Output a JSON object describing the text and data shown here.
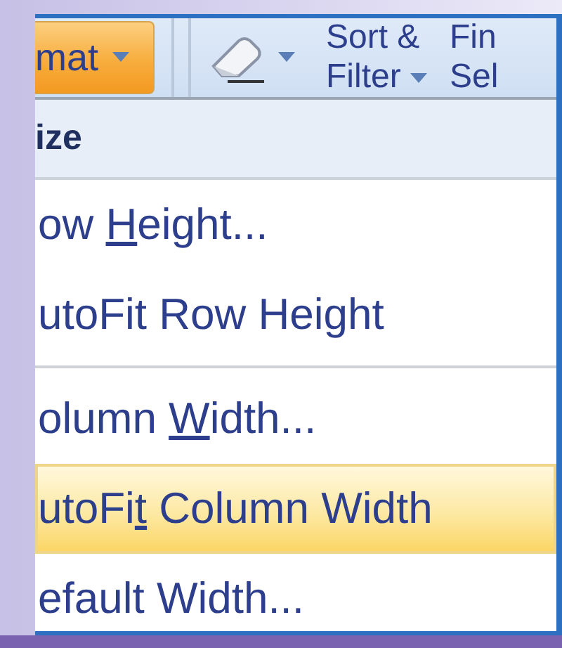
{
  "ribbon": {
    "format_button": {
      "label": "mat",
      "pressed": true
    },
    "clear_button": {
      "pressed": false
    },
    "sort_filter": {
      "line_1": "Sort &",
      "line_2": "Filter"
    },
    "find_select": {
      "line_1": "Fin",
      "line_2": "Sel"
    }
  },
  "menu": {
    "header": "ize",
    "items": [
      {
        "kind": "item",
        "selected": false,
        "parts": [
          {
            "text": "ow ",
            "underlined": false
          },
          {
            "text": "H",
            "underlined": true
          },
          {
            "text": "eight...",
            "underlined": false
          }
        ]
      },
      {
        "kind": "item",
        "selected": false,
        "parts": [
          {
            "text": "utoFit Row Height",
            "underlined": false
          }
        ]
      },
      {
        "kind": "separator"
      },
      {
        "kind": "item",
        "selected": false,
        "parts": [
          {
            "text": "olumn ",
            "underlined": false
          },
          {
            "text": "W",
            "underlined": true
          },
          {
            "text": "idth...",
            "underlined": false
          }
        ]
      },
      {
        "kind": "item",
        "selected": true,
        "parts": [
          {
            "text": "utoFi",
            "underlined": false
          },
          {
            "text": "t",
            "underlined": true
          },
          {
            "text": " Column Width",
            "underlined": false
          }
        ]
      },
      {
        "kind": "item",
        "selected": false,
        "parts": [
          {
            "text": "efault Width...",
            "underlined": false
          }
        ]
      }
    ]
  }
}
